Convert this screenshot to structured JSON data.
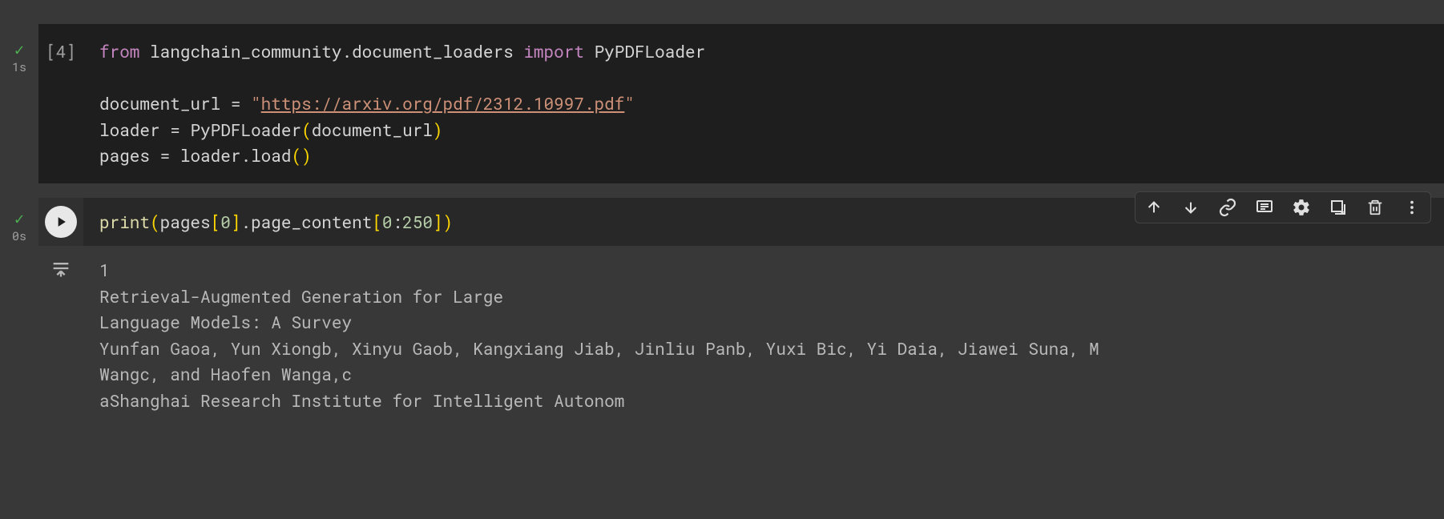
{
  "cell1": {
    "exec_count": "[4]",
    "exec_time": "1s",
    "code": {
      "from_kw": "from",
      "module": "langchain_community.document_loaders",
      "import_kw": "import",
      "imported": "PyPDFLoader",
      "var_doc": "document_url",
      "eq": "=",
      "url_open": "\"",
      "url": "https://arxiv.org/pdf/2312.10997.pdf",
      "url_close": "\"",
      "var_loader": "loader",
      "loader_cls": "PyPDFLoader",
      "arg_doc": "document_url",
      "var_pages": "pages",
      "loader_ref": "loader",
      "load_fn": "load"
    }
  },
  "cell2": {
    "exec_time": "0s",
    "code": {
      "print_fn": "print",
      "pages_ref": "pages",
      "idx0": "0",
      "attr": "page_content",
      "slice_a": "0",
      "slice_b": "250"
    },
    "output": "1\nRetrieval-Augmented Generation for Large\nLanguage Models: A Survey\nYunfan Gaoa, Yun Xiongb, Xinyu Gaob, Kangxiang Jiab, Jinliu Panb, Yuxi Bic, Yi Daia, Jiawei Suna, M\nWangc, and Haofen Wanga,c\naShanghai Research Institute for Intelligent Autonom"
  },
  "toolbar": {
    "move_up": "move-up",
    "move_down": "move-down",
    "link": "link",
    "comment": "comment",
    "settings": "settings",
    "mirror": "mirror",
    "delete": "delete",
    "more": "more"
  }
}
